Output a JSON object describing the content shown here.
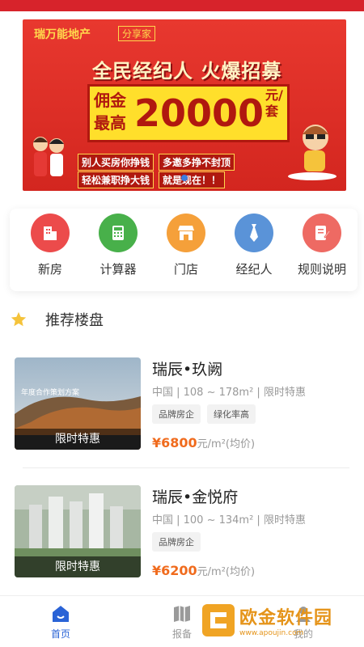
{
  "banner": {
    "brand": "瑞万能地产",
    "brand_tag": "分享家",
    "headline": "全民经纪人 火爆招募",
    "commission": "佣金最高",
    "amount": "20000",
    "unit": "元/套",
    "slogans_row1": [
      "别人买房你挣钱",
      "多邀多挣不封顶"
    ],
    "slogans_row2": [
      "轻松兼职挣大钱",
      "就是现在！！"
    ],
    "colors": {
      "background": "#d3261f",
      "plate": "#ffdf2b",
      "text": "#b0180f"
    }
  },
  "menu": {
    "items": [
      {
        "label": "新房",
        "icon": "building-icon",
        "color": "#ec4b4b"
      },
      {
        "label": "计算器",
        "icon": "calculator-icon",
        "color": "#48b04a"
      },
      {
        "label": "门店",
        "icon": "store-icon",
        "color": "#f5a03a"
      },
      {
        "label": "经纪人",
        "icon": "tie-icon",
        "color": "#5a93d8"
      },
      {
        "label": "规则说明",
        "icon": "document-edit-icon",
        "color": "#ee6a63"
      }
    ]
  },
  "section": {
    "title": "推荐楼盘",
    "icon": "star-icon",
    "icon_color": "#f5c33b"
  },
  "listings": [
    {
      "name": "瑞辰•玖阙",
      "meta": "中国 | 108 ~ 178m² | 限时特惠",
      "tags": [
        "品牌房企",
        "绿化率高"
      ],
      "price": "¥6800",
      "price_unit": "元/m²(均价)",
      "badge": "限时特惠",
      "thumb_caption": "年度合作策划方案"
    },
    {
      "name": "瑞辰•金悦府",
      "meta": "中国 | 100 ~ 134m² | 限时特惠",
      "tags": [
        "品牌房企"
      ],
      "price": "¥6200",
      "price_unit": "元/m²(均价)",
      "badge": "限时特惠"
    }
  ],
  "nav": {
    "items": [
      {
        "label": "首页",
        "icon": "home-icon",
        "active": true
      },
      {
        "label": "报备",
        "icon": "book-icon",
        "active": false
      },
      {
        "label": "我的",
        "icon": "user-icon",
        "active": false
      }
    ]
  },
  "watermark": {
    "name": "欧金软件园",
    "url": "www.apoujin.com"
  },
  "accent_color": "#2a63d6",
  "price_color": "#f06b1d"
}
